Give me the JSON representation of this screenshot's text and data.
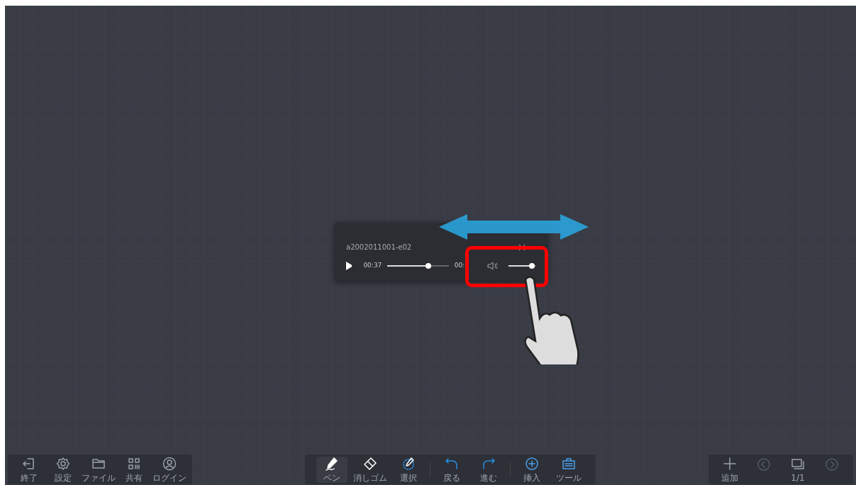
{
  "player": {
    "title": "a2002011001-e02",
    "current_time": "00:37",
    "end_time": "00:",
    "progress": {
      "level": 0.68
    },
    "volume": {
      "level": 0.95
    }
  },
  "left_toolbar": [
    {
      "label": "終了"
    },
    {
      "label": "設定"
    },
    {
      "label": "ファイル"
    },
    {
      "label": "共有"
    },
    {
      "label": "ログイン"
    }
  ],
  "center_toolbar": [
    {
      "label": "ペン",
      "selected": true
    },
    {
      "label": "消しゴム",
      "selected": false
    },
    {
      "label": "選択",
      "selected": false
    },
    {
      "label": "戻る",
      "selected": false
    },
    {
      "label": "進む",
      "selected": false
    },
    {
      "label": "挿入",
      "selected": false
    },
    {
      "label": "ツール",
      "selected": false
    }
  ],
  "right_toolbar": [
    {
      "kind": "add",
      "label": "追加"
    },
    {
      "kind": "previous"
    },
    {
      "kind": "pages",
      "label": "1/1"
    },
    {
      "kind": "next"
    }
  ]
}
